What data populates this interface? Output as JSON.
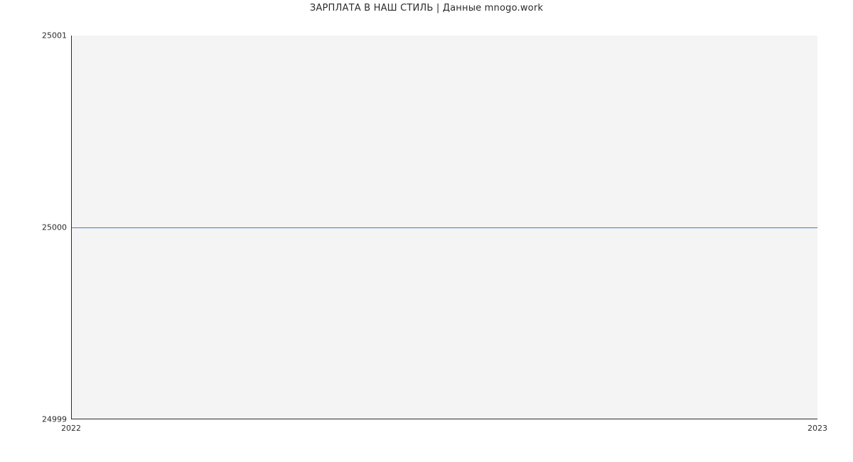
{
  "chart_data": {
    "type": "line",
    "title": "ЗАРПЛАТА В  НАШ СТИЛЬ | Данные mnogo.work",
    "xlabel": "",
    "ylabel": "",
    "x": [
      "2022",
      "2023"
    ],
    "values": [
      25000,
      25000
    ],
    "xlim": [
      "2022",
      "2023"
    ],
    "ylim": [
      24999,
      25001
    ],
    "yticks": [
      24999,
      25000,
      25001
    ],
    "xticks": [
      "2022",
      "2023"
    ],
    "grid": false,
    "line_color": "#4a78c8",
    "plot_bg": "#f4f4f4"
  }
}
